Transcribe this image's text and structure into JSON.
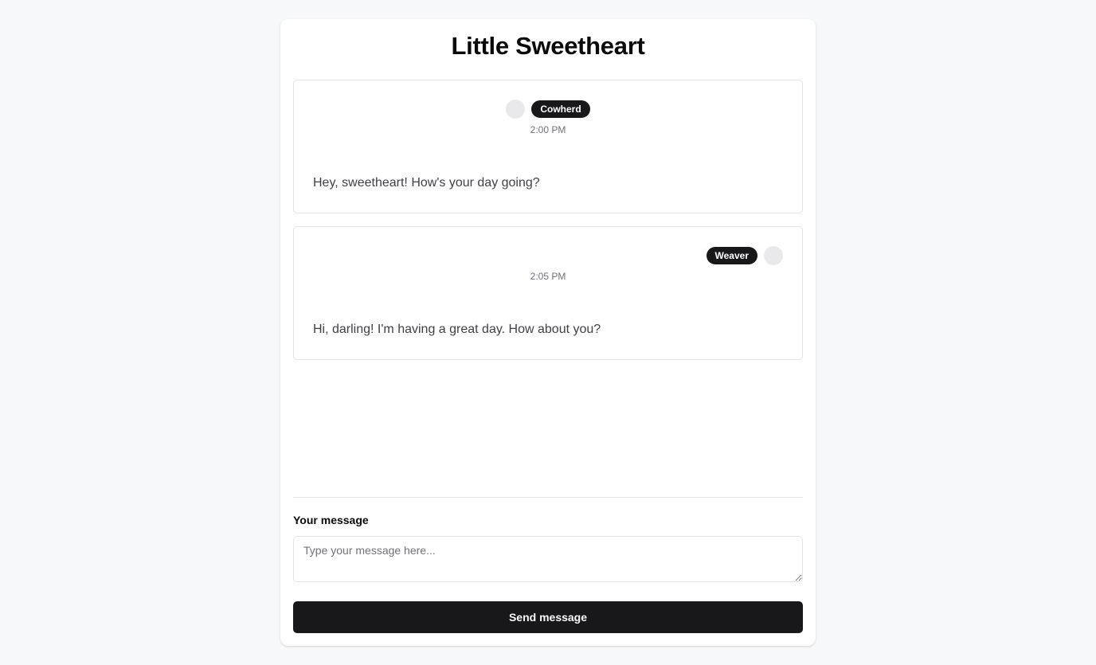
{
  "app": {
    "title": "Little Sweetheart"
  },
  "messages": [
    {
      "sender": "Cowherd",
      "time": "2:00 PM",
      "text": "Hey, sweetheart! How's your day going?",
      "align": "center"
    },
    {
      "sender": "Weaver",
      "time": "2:05 PM",
      "text": "Hi, darling! I'm having a great day. How about you?",
      "align": "right"
    }
  ],
  "composer": {
    "label": "Your message",
    "placeholder": "Type your message here...",
    "value": "",
    "send_label": "Send message"
  },
  "colors": {
    "background": "#f7f8fa",
    "card": "#ffffff",
    "accent": "#18181b",
    "muted_text": "#71717a",
    "border": "#e4e4e7"
  }
}
